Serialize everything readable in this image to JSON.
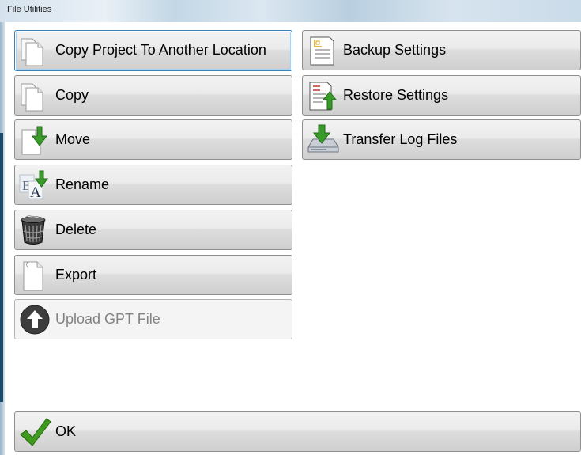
{
  "window": {
    "title": "File Utilities"
  },
  "left_buttons": [
    {
      "label": "Copy Project To Another Location",
      "icon": "document-stack-icon"
    },
    {
      "label": "Copy",
      "icon": "document-stack-icon"
    },
    {
      "label": "Move",
      "icon": "document-move-arrow-icon"
    },
    {
      "label": "Rename",
      "icon": "rename-ab-icon"
    },
    {
      "label": "Delete",
      "icon": "trash-bin-icon"
    },
    {
      "label": "Export",
      "icon": "document-icon"
    },
    {
      "label": "Upload GPT File",
      "icon": "upload-arrow-circle-icon",
      "disabled": true
    }
  ],
  "right_buttons": [
    {
      "label": "Backup Settings",
      "icon": "settings-document-icon"
    },
    {
      "label": "Restore Settings",
      "icon": "restore-settings-arrow-icon"
    },
    {
      "label": "Transfer Log Files",
      "icon": "drive-download-arrow-icon"
    }
  ],
  "ok_button": {
    "label": "OK",
    "icon": "checkmark-icon"
  },
  "colors": {
    "focus_border": "#3c7fb1",
    "arrow_green": "#3a9a2a",
    "check_green": "#3f9b1e"
  }
}
